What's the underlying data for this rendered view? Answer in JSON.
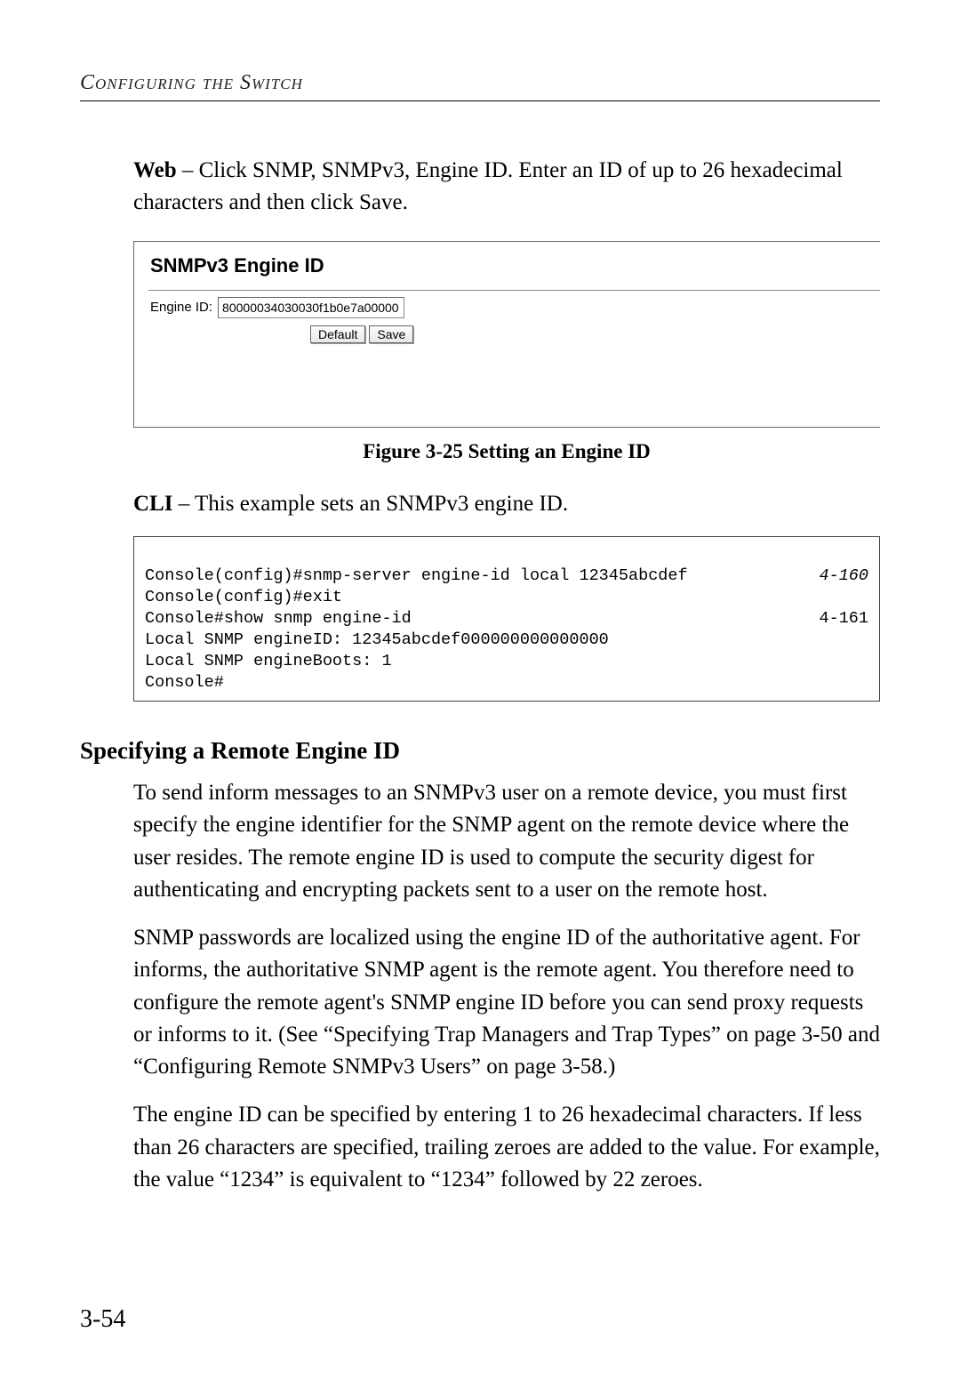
{
  "running_head": "Configuring the Switch",
  "intro_web": {
    "label": "Web",
    "text": " – Click SNMP, SNMPv3, Engine ID. Enter an ID of up to 26 hexadecimal characters and then click Save."
  },
  "figure": {
    "title": "SNMPv3 Engine ID",
    "field_label": "Engine ID:",
    "field_value": "80000034030030f1b0e7a00000",
    "btn_default": "Default",
    "btn_save": "Save",
    "caption": "Figure 3-25  Setting an Engine ID"
  },
  "intro_cli": {
    "label": "CLI",
    "text": " – This example sets an SNMPv3 engine ID."
  },
  "cli": {
    "line1": "Console(config)#snmp-server engine-id local 12345abcdef",
    "ref1": "4-160",
    "line2": "Console(config)#exit",
    "line3": "Console#show snmp engine-id",
    "ref3": "4-161",
    "line4": "Local SNMP engineID: 12345abcdef000000000000000",
    "line5": "Local SNMP engineBoots: 1",
    "line6": "Console#"
  },
  "section": {
    "heading": "Specifying a Remote Engine ID",
    "p1": "To send inform messages to an SNMPv3 user on a remote device, you must first specify the engine identifier for the SNMP agent on the remote device where the user resides. The remote engine ID is used to compute the security digest for authenticating and encrypting packets sent to a user on the remote host.",
    "p2": "SNMP passwords are localized using the engine ID of the authoritative agent. For informs, the authoritative SNMP agent is the remote agent. You therefore need to configure the remote agent's SNMP engine ID before you can send proxy requests or informs to it. (See “Specifying Trap Managers and Trap Types” on page 3-50 and “Configuring Remote SNMPv3 Users” on page 3-58.)",
    "p3": "The engine ID can be specified by entering 1 to 26 hexadecimal characters. If less than 26 characters are specified, trailing zeroes are added to the value. For example, the value “1234” is equivalent to “1234” followed by 22 zeroes."
  },
  "page_number": "3-54"
}
